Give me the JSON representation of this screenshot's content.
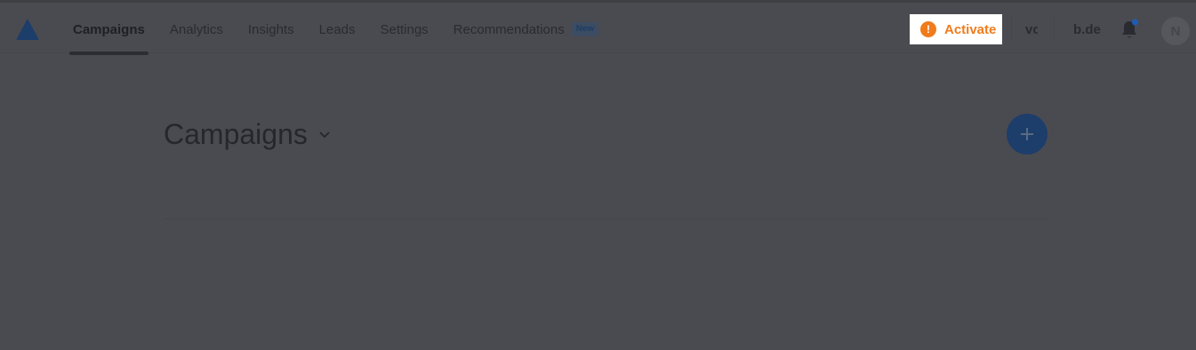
{
  "nav": {
    "items": [
      {
        "label": "Campaigns",
        "active": true
      },
      {
        "label": "Analytics",
        "active": false
      },
      {
        "label": "Insights",
        "active": false
      },
      {
        "label": "Leads",
        "active": false
      },
      {
        "label": "Settings",
        "active": false
      },
      {
        "label": "Recommendations",
        "active": false
      }
    ],
    "new_badge": "New"
  },
  "header": {
    "activate_label": "Activate",
    "activate_icon": "!",
    "truncated_text_1": "vc",
    "truncated_text_2": "b.de",
    "avatar_initial": "N",
    "notification_dot_color": "#1d5db8"
  },
  "main": {
    "title": "Campaigns"
  },
  "colors": {
    "accent_orange": "#f07b1c",
    "primary_blue": "#1d3d6b",
    "overlay_bg": "#4a4b50"
  }
}
